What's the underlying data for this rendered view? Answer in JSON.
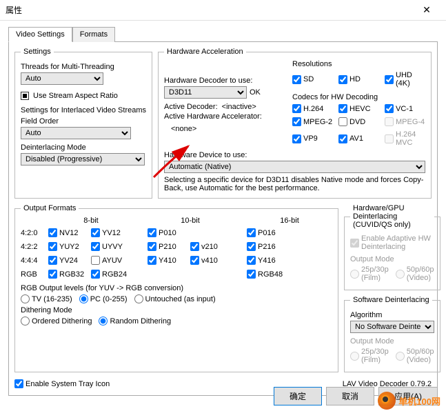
{
  "window": {
    "title": "属性",
    "close": "✕"
  },
  "tabs": {
    "video": "Video Settings",
    "formats": "Formats"
  },
  "settings": {
    "legend": "Settings",
    "threads_label": "Threads for Multi-Threading",
    "threads_value": "Auto",
    "stream_aspect": "Use Stream Aspect Ratio",
    "interlaced_label": "Settings for Interlaced Video Streams",
    "field_order_label": "Field Order",
    "field_order_value": "Auto",
    "deint_mode_label": "Deinterlacing Mode",
    "deint_mode_value": "Disabled (Progressive)"
  },
  "hw": {
    "legend": "Hardware Acceleration",
    "decoder_label": "Hardware Decoder to use:",
    "decoder_value": "D3D11",
    "decoder_ok": "OK",
    "active_decoder_label": "Active Decoder:",
    "active_decoder_value": "<inactive>",
    "active_accel_label": "Active Hardware Accelerator:",
    "active_accel_value": "<none>",
    "device_label": "Hardware Device to use:",
    "device_value": "Automatic (Native)",
    "note": "Selecting a specific device for D3D11 disables Native mode and forces Copy-Back, use Automatic for the best performance.",
    "res_label": "Resolutions",
    "res": {
      "sd": "SD",
      "hd": "HD",
      "uhd": "UHD (4K)"
    },
    "codecs_label": "Codecs for HW Decoding",
    "codecs": {
      "h264": "H.264",
      "hevc": "HEVC",
      "vc1": "VC-1",
      "mpeg2": "MPEG-2",
      "dvd": "DVD",
      "mpeg4": "MPEG-4",
      "vp9": "VP9",
      "av1": "AV1",
      "h264mvc": "H.264 MVC"
    }
  },
  "outfmt": {
    "legend": "Output Formats",
    "bits8": "8-bit",
    "bits10": "10-bit",
    "bits16": "16-bit",
    "rows": {
      "420": "4:2:0",
      "422": "4:2:2",
      "444": "4:4:4",
      "rgb": "RGB"
    },
    "f": {
      "nv12": "NV12",
      "yv12": "YV12",
      "p010": "P010",
      "p016": "P016",
      "yuy2": "YUY2",
      "uyvy": "UYVY",
      "p210": "P210",
      "v210": "v210",
      "p216": "P216",
      "yv24": "YV24",
      "ayuv": "AYUV",
      "y410": "Y410",
      "v410": "v410",
      "y416": "Y416",
      "rgb32": "RGB32",
      "rgb24": "RGB24",
      "rgb48": "RGB48"
    },
    "rgb_levels_label": "RGB Output levels (for YUV -> RGB conversion)",
    "rgb_levels": {
      "tv": "TV (16-235)",
      "pc": "PC (0-255)",
      "untouched": "Untouched (as input)"
    },
    "dither_label": "Dithering Mode",
    "dither": {
      "ordered": "Ordered Dithering",
      "random": "Random Dithering"
    }
  },
  "hwdeint": {
    "legend": "Hardware/GPU Deinterlacing (CUVID/QS only)",
    "adaptive": "Enable Adaptive HW Deinterlacing",
    "mode_label": "Output Mode",
    "film": "25p/30p (Film)",
    "video": "50p/60p (Video)"
  },
  "swdeint": {
    "legend": "Software Deinterlacing",
    "algo_label": "Algorithm",
    "algo_value": "No Software Deinterlacing",
    "mode_label": "Output Mode",
    "film": "25p/30p (Film)",
    "video": "50p/60p (Video)"
  },
  "footer": {
    "tray": "Enable System Tray Icon",
    "version": "LAV Video Decoder 0.79.2"
  },
  "buttons": {
    "ok": "确定",
    "cancel": "取消",
    "apply": "应用(A)"
  },
  "watermark": "单机100网"
}
